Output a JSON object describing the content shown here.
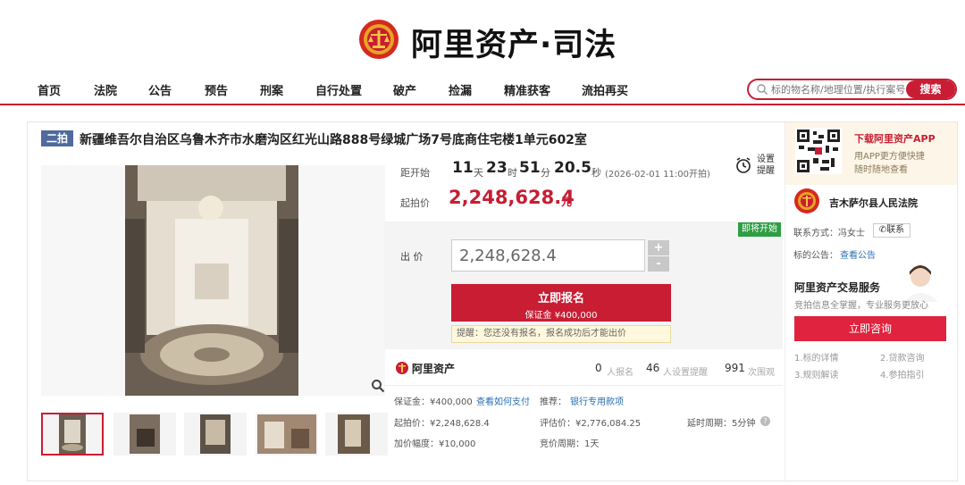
{
  "header": {
    "logo_text": "阿里资产·司法"
  },
  "nav": {
    "items": [
      "首页",
      "法院",
      "公告",
      "预告",
      "刑案",
      "自行处置",
      "破产",
      "捡漏",
      "精准获客",
      "流拍再买"
    ]
  },
  "search": {
    "placeholder": "标的物名称/地理位置/执行案号",
    "button": "搜索"
  },
  "item": {
    "tag": "二拍",
    "title": "新疆维吾尔自治区乌鲁木齐市水磨沟区红光山路888号绿城广场7号底商住宅楼1单元602室"
  },
  "countdown": {
    "label": "距开始",
    "days": "11",
    "days_unit": "天",
    "hours": "23",
    "hours_unit": "时",
    "minutes": "51",
    "minutes_unit": "分",
    "seconds": "20.5",
    "seconds_unit": "秒",
    "note": "(2026-02-01 11:00开拍)",
    "reminder": "设置提醒"
  },
  "price": {
    "label": "起拍价",
    "value": "2,248,628.4",
    "unit": "元"
  },
  "bid": {
    "badge": "即将开始",
    "label": "出 价",
    "value": "2,248,628.4",
    "plus": "+",
    "minus": "-",
    "signup": "立即报名",
    "deposit": "保证金 ¥400,000",
    "tip": "提醒：您还没有报名，报名成功后才能出价"
  },
  "stats": {
    "brand": "阿里资产",
    "signups_num": "0",
    "signups_label": "人报名",
    "reminders_num": "46",
    "reminders_label": "人设置提醒",
    "views_num": "991",
    "views_label": "次围观"
  },
  "details": {
    "deposit": "保证金：¥400,000",
    "how_to_pay": "查看如何支付",
    "recommend": "推荐：",
    "bank": "银行专用款项",
    "start_price": "起拍价：¥2,248,628.4",
    "appraisal": "评估价：¥2,776,084.25",
    "delay": "延时周期：5分钟",
    "increment": "加价幅度：¥10,000",
    "bid_cycle": "竞价周期：1天"
  },
  "sidebar": {
    "app_title": "下载阿里资产APP",
    "app_desc1": "用APP更方便快捷",
    "app_desc2": "随时随地查看",
    "court": "吉木萨尔县人民法院",
    "contact_label": "联系方式：冯女士",
    "contact_btn": "联系",
    "notice_label": "标的公告：",
    "notice_link": "查看公告",
    "service_title": "阿里资产交易服务",
    "service_desc": "竞拍信息全掌握，专业服务更放心",
    "consult_btn": "立即咨询",
    "tabs": [
      "1.标的详情",
      "2.贷款咨询",
      "3.规则解读",
      "4.参拍指引"
    ]
  },
  "colors": {
    "brand_red": "#c81d33",
    "tag_blue": "#4f6a9d",
    "badge_green": "#2e9d43",
    "link_blue": "#2a6fb5"
  }
}
